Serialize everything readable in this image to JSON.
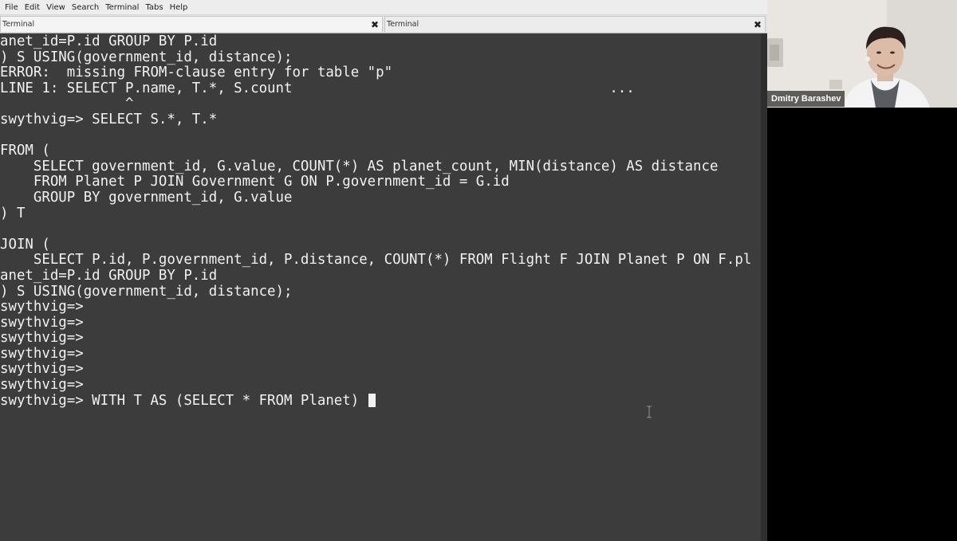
{
  "menubar": {
    "items": [
      "File",
      "Edit",
      "View",
      "Search",
      "Terminal",
      "Tabs",
      "Help"
    ]
  },
  "tabs": [
    {
      "label": "Terminal",
      "close_icon": "close-icon"
    },
    {
      "label": "Terminal",
      "close_icon": "close-icon"
    }
  ],
  "terminal": {
    "lines": [
      "anet_id=P.id GROUP BY P.id",
      ") S USING(government_id, distance);",
      "ERROR:  missing FROM-clause entry for table \"p\"",
      "LINE 1: SELECT P.name, T.*, S.count                                      ...",
      "               ^",
      "swythvig=> SELECT S.*, T.*",
      "",
      "FROM (",
      "    SELECT government_id, G.value, COUNT(*) AS planet_count, MIN(distance) AS distance",
      "    FROM Planet P JOIN Government G ON P.government_id = G.id",
      "    GROUP BY government_id, G.value",
      ") T",
      "",
      "JOIN (",
      "    SELECT P.id, P.government_id, P.distance, COUNT(*) FROM Flight F JOIN Planet P ON F.pl",
      "anet_id=P.id GROUP BY P.id",
      ") S USING(government_id, distance);",
      "swythvig=>",
      "swythvig=>",
      "swythvig=>",
      "swythvig=>",
      "swythvig=>",
      "swythvig=>",
      "swythvig=> WITH T AS (SELECT * FROM Planet) "
    ],
    "cursor": "block-cursor"
  },
  "video": {
    "participant_name": "Dmitry Barashev"
  },
  "colors": {
    "terminal_bg": "#3c3c3c",
    "terminal_fg": "#f2f2f2",
    "menubar_bg": "#ededed"
  }
}
